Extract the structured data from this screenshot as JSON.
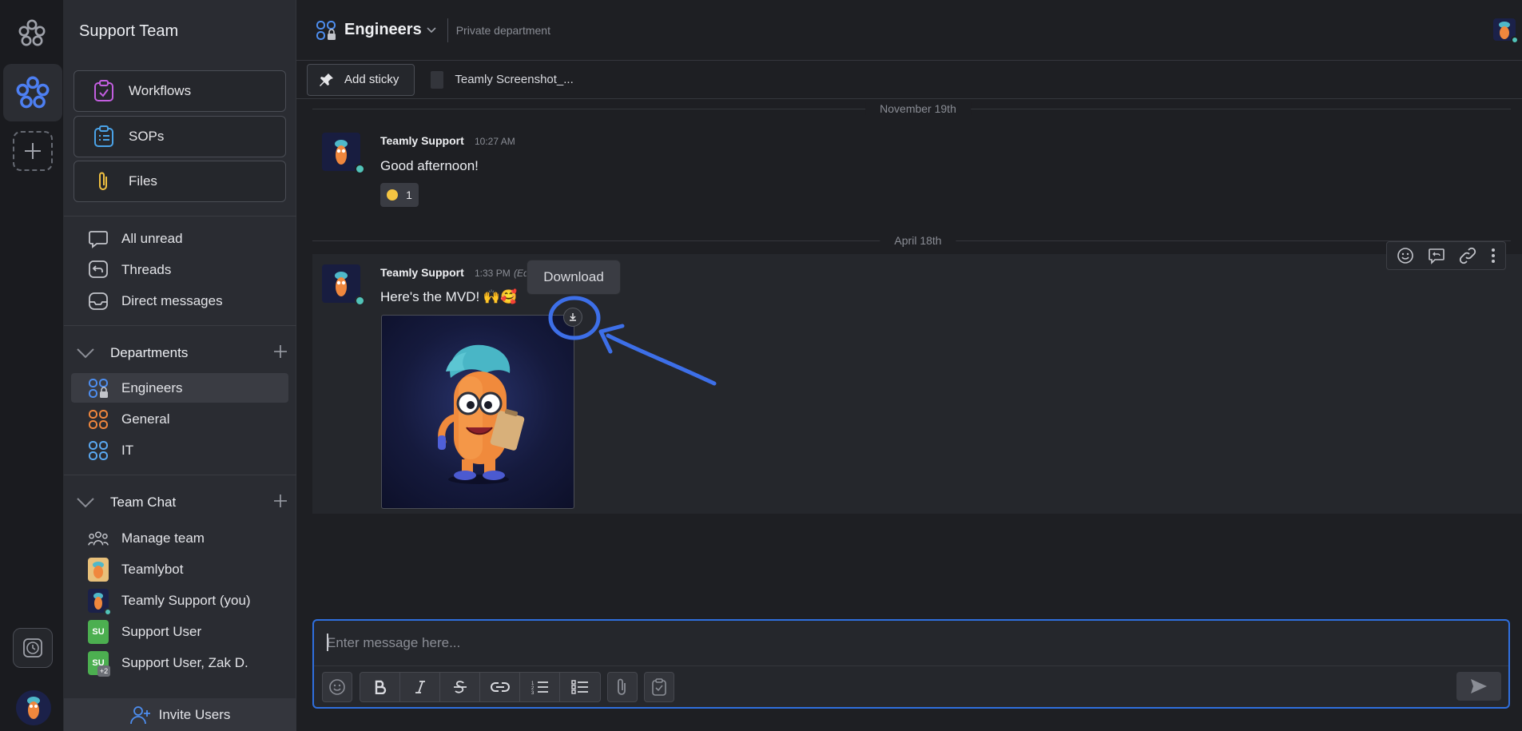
{
  "workspace": {
    "name": "Support Team"
  },
  "tools": [
    {
      "label": "Workflows",
      "icon": "workflow-icon"
    },
    {
      "label": "SOPs",
      "icon": "clipboard-icon"
    },
    {
      "label": "Files",
      "icon": "paperclip-icon"
    }
  ],
  "nav": [
    {
      "label": "All unread",
      "icon": "speech-bubble-icon"
    },
    {
      "label": "Threads",
      "icon": "threads-icon"
    },
    {
      "label": "Direct messages",
      "icon": "inbox-icon"
    }
  ],
  "departments": {
    "title": "Departments",
    "items": [
      {
        "label": "Engineers",
        "color": "#4d8ef0",
        "active": true
      },
      {
        "label": "General",
        "color": "#f0873d"
      },
      {
        "label": "IT",
        "color": "#5aa9f2"
      }
    ]
  },
  "team_chat": {
    "title": "Team Chat",
    "items": [
      {
        "label": "Manage team",
        "icon": "team-icon"
      },
      {
        "label": "Teamlybot",
        "avatar": "teamlybot"
      },
      {
        "label": "Teamly Support (you)",
        "avatar": "teamly-support"
      },
      {
        "label": "Support User",
        "initials": "SU",
        "color": "#4caf50"
      },
      {
        "label": "Support User, Zak D.",
        "initials": "SU",
        "badge": "+2",
        "color": "#4caf50"
      }
    ]
  },
  "invite": {
    "label": "Invite Users"
  },
  "channel": {
    "name": "Engineers",
    "description": "Private department"
  },
  "sticky": {
    "add_label": "Add sticky",
    "file_label": "Teamly Screenshot_..."
  },
  "dates": [
    "November 19th",
    "April 18th"
  ],
  "messages": [
    {
      "author": "Teamly Support",
      "time": "10:27 AM",
      "text": "Good afternoon!",
      "reaction": {
        "emoji": "grinning-face",
        "count": "1"
      }
    },
    {
      "author": "Teamly Support",
      "time": "1:33 PM",
      "edited": "(Ed",
      "text": "Here's the MVD! 🙌🥰",
      "attachment": "image"
    }
  ],
  "tooltip": {
    "label": "Download"
  },
  "composer": {
    "placeholder": "Enter message here..."
  },
  "colors": {
    "accent": "#2f6fde",
    "annotation": "#3d6fe8",
    "online": "#51c3b8"
  }
}
